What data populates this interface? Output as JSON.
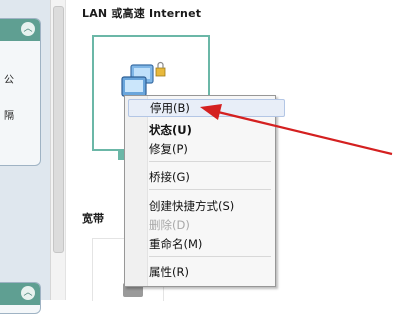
{
  "network": {
    "section_lan": "LAN 或高速 Internet",
    "section_broadband": "宽带"
  },
  "sidebar": {
    "glyph1": "公",
    "glyph2": "隔"
  },
  "context_menu": {
    "items": [
      {
        "label": "停用(B)",
        "bold": false,
        "disabled": false,
        "highlighted": true
      },
      {
        "label": "状态(U)",
        "bold": true,
        "disabled": false
      },
      {
        "label": "修复(P)",
        "bold": false,
        "disabled": false
      },
      {
        "label": "桥接(G)",
        "bold": false,
        "disabled": false
      },
      {
        "label": "创建快捷方式(S)",
        "bold": false,
        "disabled": false
      },
      {
        "label": "删除(D)",
        "bold": false,
        "disabled": true
      },
      {
        "label": "重命名(M)",
        "bold": false,
        "disabled": false
      },
      {
        "label": "属性(R)",
        "bold": false,
        "disabled": false
      }
    ]
  },
  "colors": {
    "accent_teal": "#6bb7a7",
    "arrow_red": "#d42020"
  }
}
